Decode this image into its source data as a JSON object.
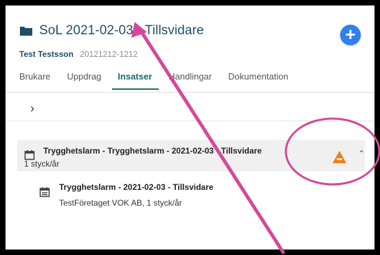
{
  "header": {
    "title": "SoL 2021-02-03 - Tillsvidare",
    "person_name": "Test Testsson",
    "person_id": "20121212-1212"
  },
  "tabs": [
    {
      "label": "Brukare"
    },
    {
      "label": "Uppdrag"
    },
    {
      "label": "Insatser"
    },
    {
      "label": "Handlingar"
    },
    {
      "label": "Dokumentation"
    }
  ],
  "active_tab": "Insatser",
  "group": {
    "title": "Trygghetslarm - Trygghetslarm - 2021-02-03 - Tillsvidare",
    "subtitle": "1 styck/år",
    "warning_icon": "warning-triangle-icon",
    "warning_color": "#f07c1a"
  },
  "child": {
    "title": "Trygghetslarm - 2021-02-03 - Tillsvidare",
    "subtitle": "TestFöretaget VOK AB, 1 styck/år"
  },
  "annotation_color": "#d6479a",
  "accent_color": "#1a6b6b",
  "button_color": "#2f80ed"
}
